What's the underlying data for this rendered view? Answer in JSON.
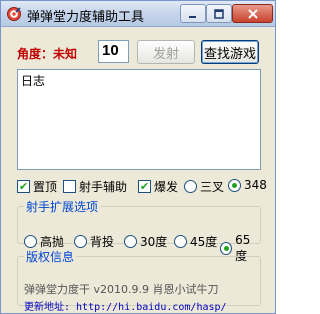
{
  "window": {
    "title": "弹弹堂力度辅助工具",
    "icon": "target-icon",
    "controls": {
      "minimize": "minimize-icon",
      "maximize": "maximize-icon",
      "close": "close-icon"
    }
  },
  "top": {
    "angle_label": "角度：未知",
    "angle_value": "10",
    "fire_button": "发射",
    "find_button": "查找游戏"
  },
  "log": {
    "text": "日志"
  },
  "options": {
    "pin": {
      "label": "置顶",
      "checked": true
    },
    "aim": {
      "label": "射手辅助",
      "checked": false
    },
    "burst": {
      "label": "爆发",
      "checked": true
    },
    "triple": {
      "label": "三叉",
      "selected": false
    },
    "v348": {
      "label": "348",
      "selected": true
    }
  },
  "shooter": {
    "legend": "射手扩展选项",
    "radios": [
      {
        "label": "高抛",
        "selected": false
      },
      {
        "label": "背投",
        "selected": false
      },
      {
        "label": "30度",
        "selected": false
      },
      {
        "label": "45度",
        "selected": false
      },
      {
        "label": "65度",
        "selected": true
      }
    ]
  },
  "version": {
    "legend": "版权信息",
    "line1": "弹弹堂力度干 v2010.9.9  肖恩小试牛刀",
    "line2": "更新地址: http://hi.baidu.com/hasp/"
  }
}
